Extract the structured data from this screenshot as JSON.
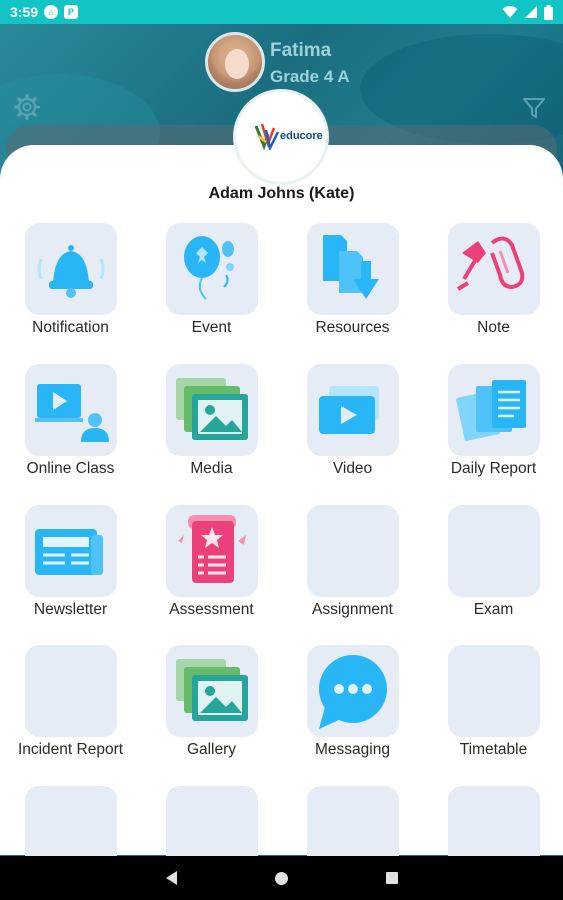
{
  "status_bar": {
    "time": "3:59"
  },
  "header": {
    "student_name": "Fatima",
    "grade": "Grade 4 A"
  },
  "logo": {
    "text": "educore"
  },
  "user": {
    "name": "Adam Johns (Kate)"
  },
  "menu": [
    {
      "label": "Notification",
      "icon": "bell-icon"
    },
    {
      "label": "Event",
      "icon": "balloon-icon"
    },
    {
      "label": "Resources",
      "icon": "download-docs-icon"
    },
    {
      "label": "Note",
      "icon": "paperclip-pin-icon"
    },
    {
      "label": "Online Class",
      "icon": "video-lesson-icon"
    },
    {
      "label": "Media",
      "icon": "media-image-icon"
    },
    {
      "label": "Video",
      "icon": "video-play-icon"
    },
    {
      "label": "Daily Report",
      "icon": "report-docs-icon"
    },
    {
      "label": "Newsletter",
      "icon": "newsletter-icon"
    },
    {
      "label": "Assessment",
      "icon": "assessment-scroll-icon"
    },
    {
      "label": "Assignment",
      "icon": "blank-icon"
    },
    {
      "label": "Exam",
      "icon": "blank-icon"
    },
    {
      "label": "Incident Report",
      "icon": "blank-icon"
    },
    {
      "label": "Gallery",
      "icon": "gallery-image-icon"
    },
    {
      "label": "Messaging",
      "icon": "chat-bubble-icon"
    },
    {
      "label": "Timetable",
      "icon": "blank-icon"
    },
    {
      "label": "",
      "icon": "blank-icon"
    },
    {
      "label": "",
      "icon": "blank-icon"
    },
    {
      "label": "",
      "icon": "blank-icon"
    },
    {
      "label": "",
      "icon": "blank-icon"
    }
  ],
  "colors": {
    "status_bar": "#12c4c4",
    "tile_bg": "#e6ecf5",
    "accent_blue": "#29b6f6",
    "accent_pink": "#ec407a"
  }
}
